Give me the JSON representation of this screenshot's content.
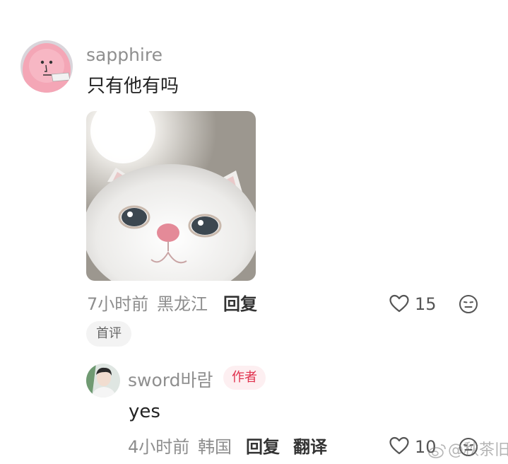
{
  "comment": {
    "username": "sapphire",
    "text": "只有他有吗",
    "time": "7小时前",
    "location": "黑龙江",
    "reply_label": "回复",
    "likes": "15",
    "first_badge": "首评"
  },
  "reply": {
    "username": "sword바람",
    "author_badge": "作者",
    "text": "yes",
    "time": "4小时前",
    "location": "韩国",
    "reply_label": "回复",
    "translate_label": "翻译",
    "likes": "10"
  },
  "watermark": "@秋茶旧~",
  "colors": {
    "author_badge_text": "#e0304d",
    "author_badge_bg": "#fdeff1",
    "meta_text": "#8d8d8d"
  },
  "icons": {
    "like": "heart-outline-icon",
    "dislike": "meh-face-icon",
    "watermark_logo": "weibo-icon"
  }
}
